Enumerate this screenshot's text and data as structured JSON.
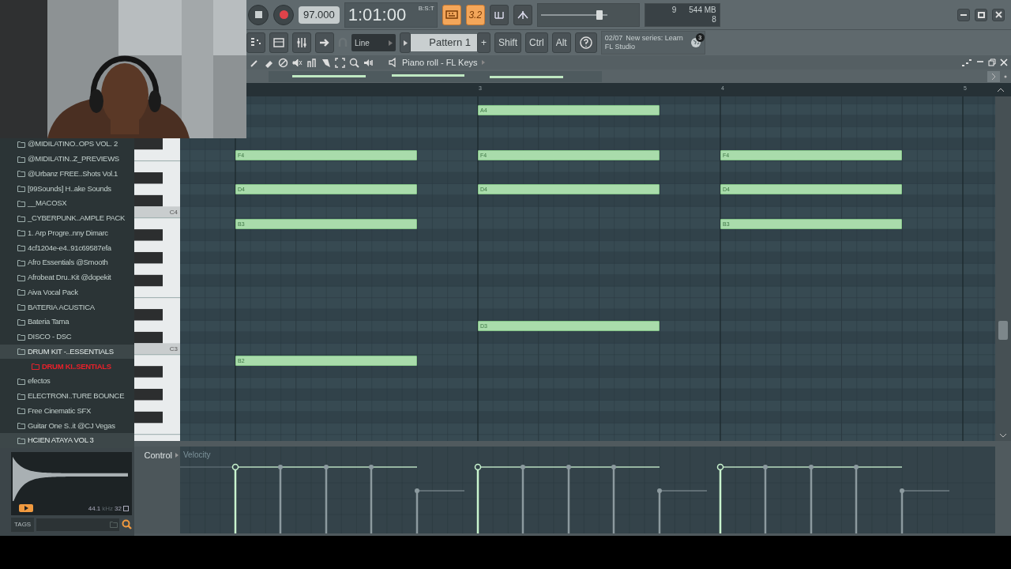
{
  "toolbar": {
    "tempo": "97.000",
    "time": "1:01:00",
    "time_unit": "B:S:T",
    "toggles": [
      {
        "kind": "typing-keyboard",
        "on": true
      },
      {
        "kind": "countdown",
        "label": "3.2",
        "on": true
      },
      {
        "kind": "loop-record",
        "on": false
      },
      {
        "kind": "blend",
        "on": false
      }
    ],
    "master_volume": {
      "level": 0.92
    },
    "cpu": "9",
    "memory": "544 MB",
    "polyphony": "8",
    "snap": "Line",
    "pattern": "Pattern 1",
    "pattern_add": "+",
    "modifier_keys": [
      "Shift",
      "Ctrl",
      "Alt"
    ],
    "hint": {
      "date": "02/07",
      "title": "New series: Learn",
      "subtitle": "FL Studio"
    },
    "news_badge": "3"
  },
  "browser": {
    "items": [
      {
        "label": "@MIDILATINO..OPS VOL. 2",
        "highlighted": false,
        "selected": false
      },
      {
        "label": "@MIDILATIN..Z_PREVIEWS",
        "highlighted": false,
        "selected": false
      },
      {
        "label": "@Urbanz FREE..Shots Vol.1",
        "highlighted": false,
        "selected": false
      },
      {
        "label": "[99Sounds] H..ake Sounds",
        "highlighted": false,
        "selected": false
      },
      {
        "label": "__MACOSX",
        "highlighted": false,
        "selected": false
      },
      {
        "label": "_CYBERPUNK..AMPLE PACK",
        "highlighted": false,
        "selected": false
      },
      {
        "label": "1. Arp Progre..nny Dimarc",
        "highlighted": false,
        "selected": false
      },
      {
        "label": "4cf1204e-e4..91c69587efa",
        "highlighted": false,
        "selected": false
      },
      {
        "label": "Afro Essentials @Smooth",
        "highlighted": false,
        "selected": false
      },
      {
        "label": "Afrobeat Dru..Kit @dopekit",
        "highlighted": false,
        "selected": false
      },
      {
        "label": "Aiva Vocal Pack",
        "highlighted": false,
        "selected": false
      },
      {
        "label": "BATERIA ACUSTICA",
        "highlighted": false,
        "selected": false
      },
      {
        "label": "Bateria Tama",
        "highlighted": false,
        "selected": false
      },
      {
        "label": "DISCO - DSC",
        "highlighted": false,
        "selected": false
      },
      {
        "label": "DRUM KIT -..ESSENTIALS",
        "highlighted": true,
        "selected": false,
        "children": [
          {
            "label": "DRUM KI..SENTIALS",
            "highlighted": false,
            "selected": true
          }
        ]
      },
      {
        "label": "efectos",
        "highlighted": false,
        "selected": false
      },
      {
        "label": "ELECTRONI..TURE BOUNCE",
        "highlighted": false,
        "selected": false
      },
      {
        "label": "Free Cinematic SFX",
        "highlighted": false,
        "selected": false
      },
      {
        "label": "Guitar One S..it @CJ Vegas",
        "highlighted": false,
        "selected": false
      },
      {
        "label": "HCIEN ATAYA VOL 3",
        "highlighted": true,
        "selected": false
      }
    ],
    "preview": {
      "sample_rate": "44.1",
      "unit": "kHz",
      "bits": "32"
    },
    "tags_label": "TAGS"
  },
  "piano_roll": {
    "title": "Piano roll - FL Keys",
    "ruler": [
      "3",
      "4",
      "5"
    ],
    "key_labels": [
      "C4",
      "C3"
    ],
    "note_columns": [
      {
        "notes": [
          {
            "label": "F4"
          },
          {
            "label": "D4"
          },
          {
            "label": "B3"
          },
          {
            "label": "B2"
          }
        ]
      },
      {
        "notes": [
          {
            "label": "A4"
          },
          {
            "label": "F4"
          },
          {
            "label": "D4"
          },
          {
            "label": "D3"
          }
        ]
      },
      {
        "notes": [
          {
            "label": "F4"
          },
          {
            "label": "D4"
          },
          {
            "label": "B3"
          }
        ]
      }
    ],
    "control": {
      "label": "Control",
      "parameter": "Velocity"
    }
  }
}
